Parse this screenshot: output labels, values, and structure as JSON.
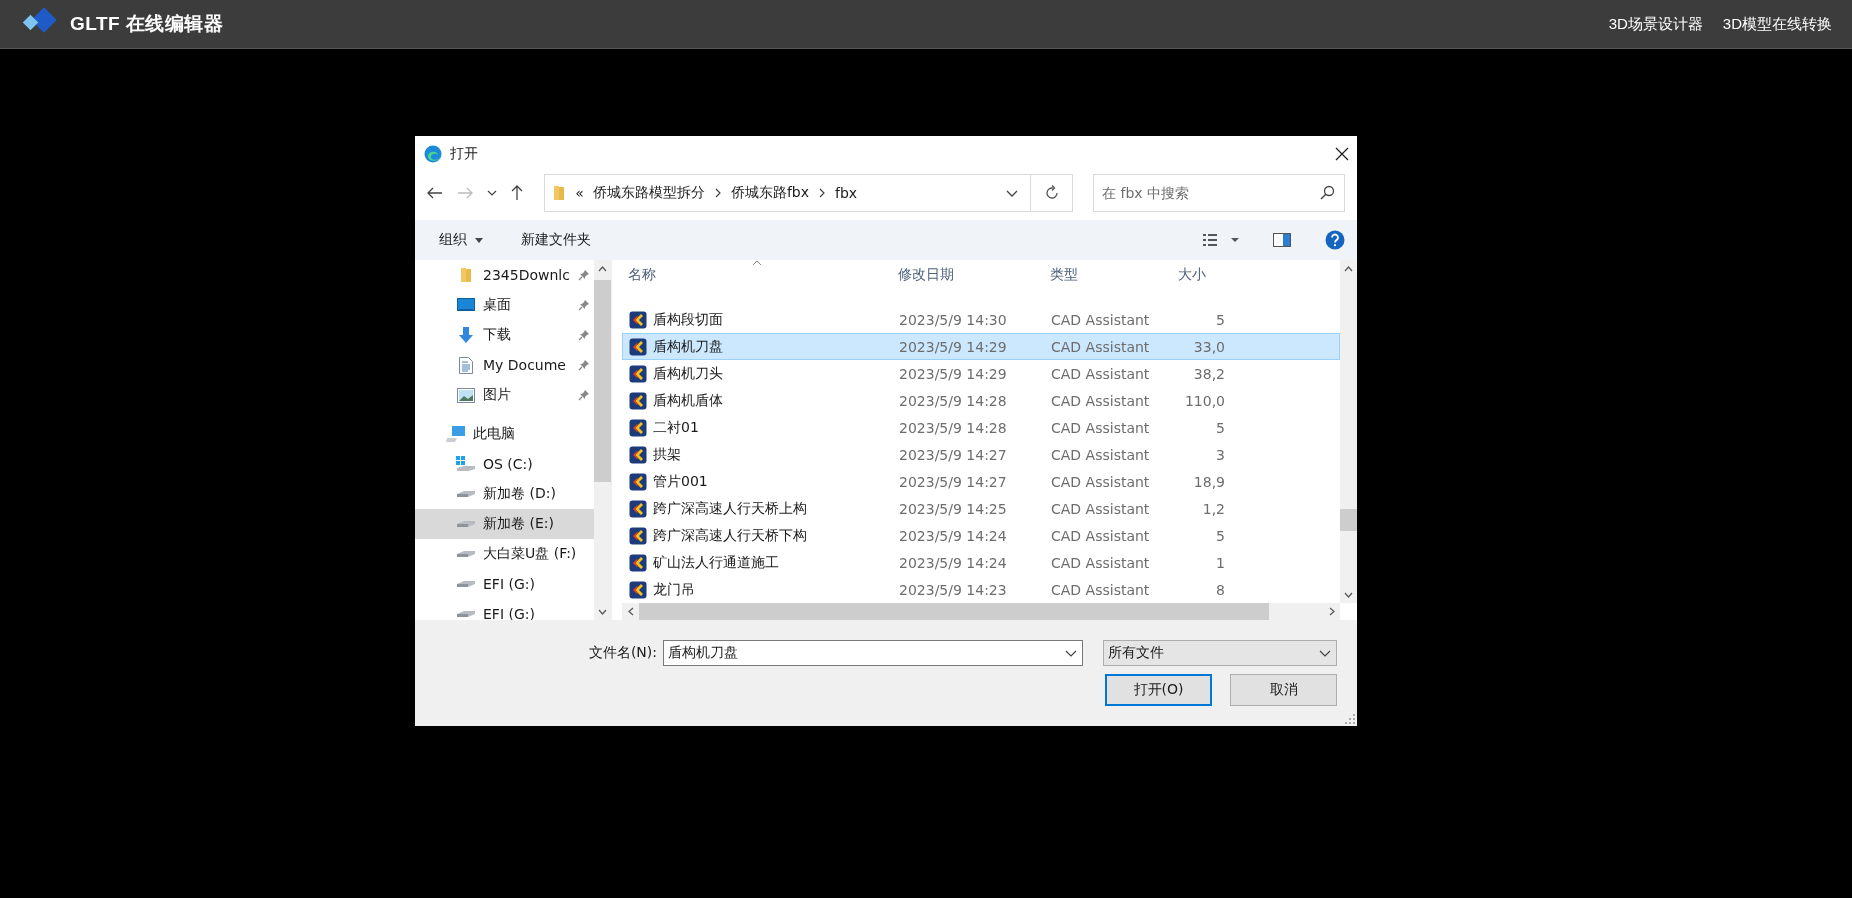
{
  "app": {
    "title": "GLTF 在线编辑器",
    "nav": [
      {
        "label": "3D场景设计器"
      },
      {
        "label": "3D模型在线转换"
      }
    ]
  },
  "dialog": {
    "title": "打开",
    "address": {
      "overflow": "«",
      "crumbs": [
        "侨城东路模型拆分",
        "侨城东路fbx",
        "fbx"
      ]
    },
    "search": {
      "placeholder": "在 fbx 中搜索"
    },
    "toolbar": {
      "organize": "组织",
      "new_folder": "新建文件夹"
    },
    "sidebar": {
      "quick_access": [
        {
          "label": "2345Downlc",
          "kind": "folder",
          "selected": false
        },
        {
          "label": "桌面",
          "kind": "desktop",
          "selected": false
        },
        {
          "label": "下载",
          "kind": "download",
          "selected": false
        },
        {
          "label": "My Docume",
          "kind": "document",
          "selected": false
        },
        {
          "label": "图片",
          "kind": "pictures",
          "selected": false
        }
      ],
      "this_pc": {
        "label": "此电脑",
        "children": [
          {
            "label": "OS (C:)",
            "kind": "system-drive",
            "selected": false
          },
          {
            "label": "新加卷 (D:)",
            "kind": "drive",
            "selected": false
          },
          {
            "label": "新加卷 (E:)",
            "kind": "drive",
            "selected": true
          },
          {
            "label": "大白菜U盘 (F:)",
            "kind": "drive",
            "selected": false
          },
          {
            "label": "EFI (G:)",
            "kind": "drive",
            "selected": false
          },
          {
            "label": "EFI (G:)",
            "kind": "drive",
            "selected": false
          }
        ]
      }
    },
    "table": {
      "columns": [
        "名称",
        "修改日期",
        "类型",
        "大小"
      ],
      "rows": [
        {
          "name": "盾构段切面",
          "date": "2023/5/9 14:30",
          "type": "CAD Assistant",
          "size": "5",
          "selected": false
        },
        {
          "name": "盾构机刀盘",
          "date": "2023/5/9 14:29",
          "type": "CAD Assistant",
          "size": "33,0",
          "selected": true
        },
        {
          "name": "盾构机刀头",
          "date": "2023/5/9 14:29",
          "type": "CAD Assistant",
          "size": "38,2",
          "selected": false
        },
        {
          "name": "盾构机盾体",
          "date": "2023/5/9 14:28",
          "type": "CAD Assistant",
          "size": "110,0",
          "selected": false
        },
        {
          "name": "二衬01",
          "date": "2023/5/9 14:28",
          "type": "CAD Assistant",
          "size": "5",
          "selected": false
        },
        {
          "name": "拱架",
          "date": "2023/5/9 14:27",
          "type": "CAD Assistant",
          "size": "3",
          "selected": false
        },
        {
          "name": "管片001",
          "date": "2023/5/9 14:27",
          "type": "CAD Assistant",
          "size": "18,9",
          "selected": false
        },
        {
          "name": "跨广深高速人行天桥上构",
          "date": "2023/5/9 14:25",
          "type": "CAD Assistant",
          "size": "1,2",
          "selected": false
        },
        {
          "name": "跨广深高速人行天桥下构",
          "date": "2023/5/9 14:24",
          "type": "CAD Assistant",
          "size": "5",
          "selected": false
        },
        {
          "name": "矿山法人行通道施工",
          "date": "2023/5/9 14:24",
          "type": "CAD Assistant",
          "size": "1",
          "selected": false
        },
        {
          "name": "龙门吊",
          "date": "2023/5/9 14:23",
          "type": "CAD Assistant",
          "size": "8",
          "selected": false
        }
      ]
    },
    "filename": {
      "label": "文件名(N):",
      "value": "盾构机刀盘"
    },
    "filter": {
      "value": "所有文件"
    },
    "buttons": [
      {
        "label": "打开(O)",
        "kind": "primary"
      },
      {
        "label": "取消",
        "kind": "cancel"
      }
    ]
  }
}
